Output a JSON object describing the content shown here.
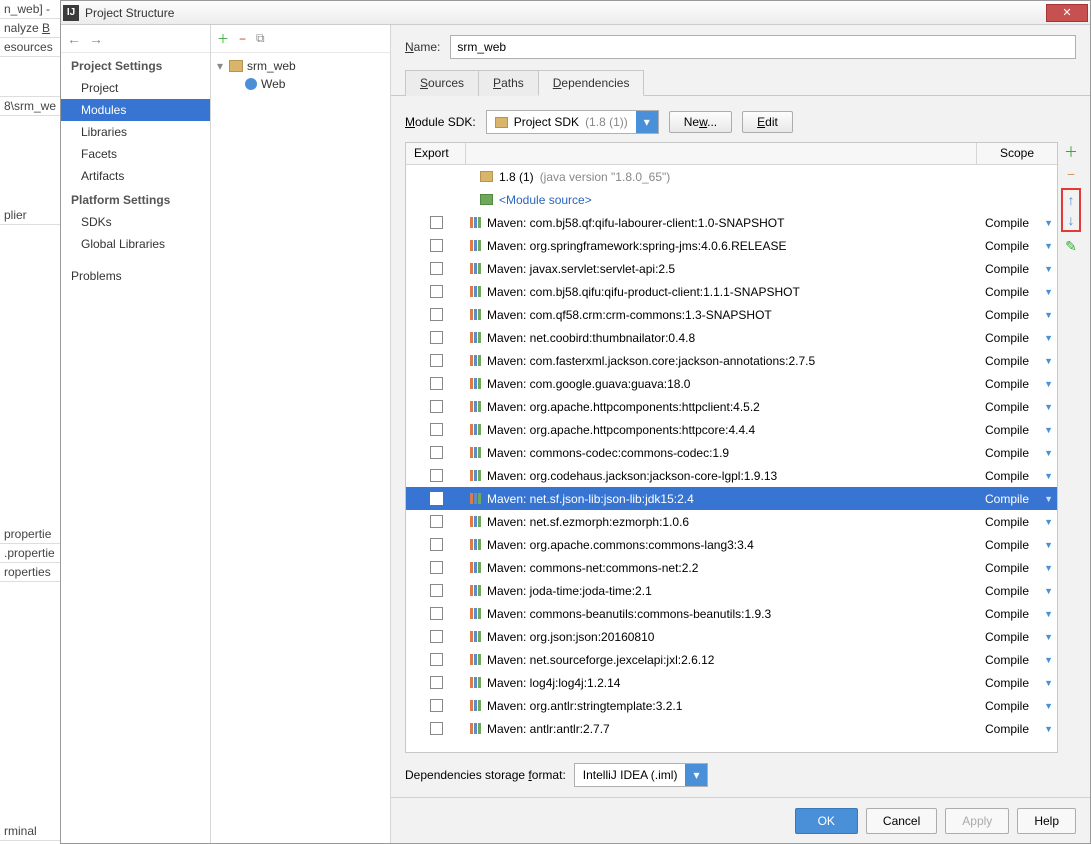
{
  "bg": {
    "frag1": "n_web] -",
    "frag2": "nalyze",
    "frag3": "esources",
    "frag4": "8\\srm_we",
    "frag5": "plier",
    "frag6": "propertie",
    "frag7": ".propertie",
    "frag8": "roperties",
    "frag9": "rminal"
  },
  "title": "Project Structure",
  "nav": {
    "section1": "Project Settings",
    "items1": [
      "Project",
      "Modules",
      "Libraries",
      "Facets",
      "Artifacts"
    ],
    "section2": "Platform Settings",
    "items2": [
      "SDKs",
      "Global Libraries"
    ],
    "problems": "Problems"
  },
  "tree": {
    "root": "srm_web",
    "child": "Web"
  },
  "name": {
    "label": "Name:",
    "value": "srm_web"
  },
  "tabs": [
    "Sources",
    "Paths",
    "Dependencies"
  ],
  "sdk": {
    "label": "Module SDK:",
    "selected": "Project SDK",
    "ver": "(1.8 (1))",
    "new": "New...",
    "edit": "Edit"
  },
  "table": {
    "h_export": "Export",
    "h_scope": "Scope",
    "jdk": "1.8 (1)",
    "jdk_note": "(java version \"1.8.0_65\")",
    "module_src": "<Module source>",
    "scope_compile": "Compile",
    "deps": [
      "Maven: com.bj58.qf:qifu-labourer-client:1.0-SNAPSHOT",
      "Maven: org.springframework:spring-jms:4.0.6.RELEASE",
      "Maven: javax.servlet:servlet-api:2.5",
      "Maven: com.bj58.qifu:qifu-product-client:1.1.1-SNAPSHOT",
      "Maven: com.qf58.crm:crm-commons:1.3-SNAPSHOT",
      "Maven: net.coobird:thumbnailator:0.4.8",
      "Maven: com.fasterxml.jackson.core:jackson-annotations:2.7.5",
      "Maven: com.google.guava:guava:18.0",
      "Maven: org.apache.httpcomponents:httpclient:4.5.2",
      "Maven: org.apache.httpcomponents:httpcore:4.4.4",
      "Maven: commons-codec:commons-codec:1.9",
      "Maven: org.codehaus.jackson:jackson-core-lgpl:1.9.13",
      "Maven: net.sf.json-lib:json-lib:jdk15:2.4",
      "Maven: net.sf.ezmorph:ezmorph:1.0.6",
      "Maven: org.apache.commons:commons-lang3:3.4",
      "Maven: commons-net:commons-net:2.2",
      "Maven: joda-time:joda-time:2.1",
      "Maven: commons-beanutils:commons-beanutils:1.9.3",
      "Maven: org.json:json:20160810",
      "Maven: net.sourceforge.jexcelapi:jxl:2.6.12",
      "Maven: log4j:log4j:1.2.14",
      "Maven: org.antlr:stringtemplate:3.2.1",
      "Maven: antlr:antlr:2.7.7"
    ],
    "selected_index": 12
  },
  "storage": {
    "label": "Dependencies storage format:",
    "value": "IntelliJ IDEA (.iml)"
  },
  "footer": {
    "ok": "OK",
    "cancel": "Cancel",
    "apply": "Apply",
    "help": "Help"
  }
}
